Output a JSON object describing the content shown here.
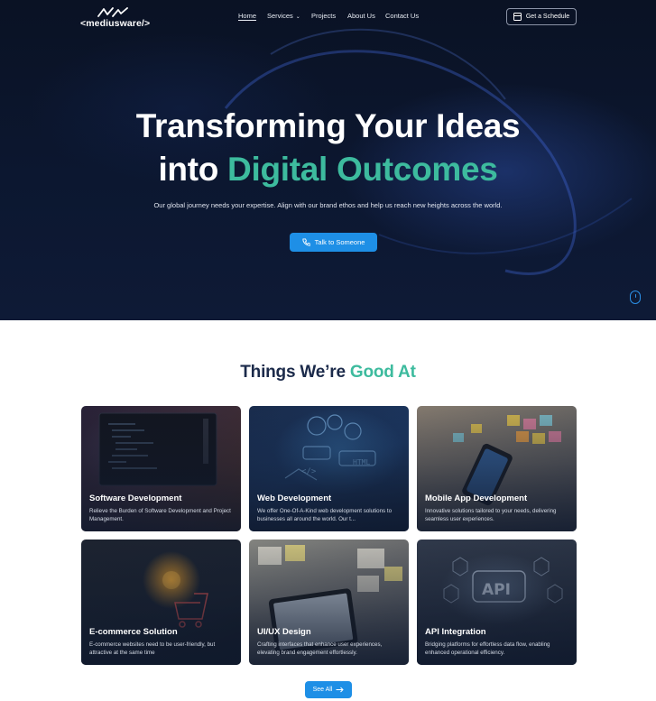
{
  "header": {
    "logo_text": "<mediusware/>",
    "nav": [
      {
        "label": "Home",
        "active": true
      },
      {
        "label": "Services",
        "has_dropdown": true
      },
      {
        "label": "Projects"
      },
      {
        "label": "About Us"
      },
      {
        "label": "Contact Us"
      }
    ],
    "cta_label": "Get a Schedule"
  },
  "hero": {
    "title_line1": "Transforming Your Ideas",
    "title_line2_plain": "into ",
    "title_line2_accent": "Digital Outcomes",
    "subtitle": "Our global journey needs your expertise. Align with our brand ethos and help us reach new heights across the world.",
    "button_label": "Talk to Someone"
  },
  "services": {
    "title_plain": "Things We’re ",
    "title_accent": "Good At",
    "cards": [
      {
        "title": "Software Development",
        "description": "Relieve the Burden of Software Development and Project Management."
      },
      {
        "title": "Web Development",
        "description": "We offer One-Of-A-Kind web development solutions to businesses all around the world. Our t..."
      },
      {
        "title": "Mobile App Development",
        "description": "Innovative solutions tailored to your needs, delivering seamless user experiences."
      },
      {
        "title": "E-commerce Solution",
        "description": "E-commerce websites need to be user-friendly, but attractive at the same time"
      },
      {
        "title": "UI/UX Design",
        "description": "Crafting interfaces that enhance user experiences, elevating brand engagement effortlessly."
      },
      {
        "title": "API Integration",
        "description": "Bridging platforms for effortless data flow, enabling enhanced operational efficiency."
      }
    ],
    "see_all_label": "See All"
  },
  "colors": {
    "accent_green": "#3dbb9e",
    "primary_blue": "#1e8fe6",
    "heading_navy": "#1b2a4a",
    "hero_bg": "#0a1224"
  }
}
